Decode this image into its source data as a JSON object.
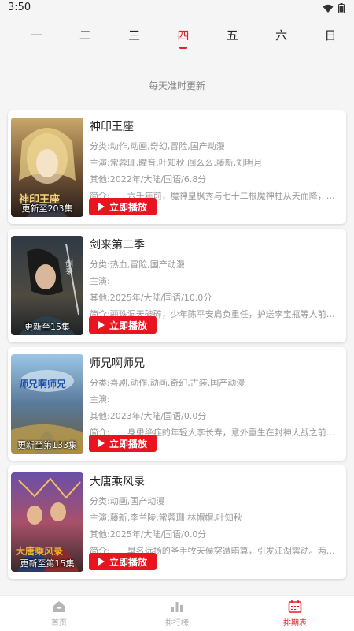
{
  "status": {
    "time": "3:50"
  },
  "days": [
    {
      "label": "一",
      "active": false
    },
    {
      "label": "二",
      "active": false
    },
    {
      "label": "三",
      "active": false
    },
    {
      "label": "四",
      "active": true
    },
    {
      "label": "五",
      "active": false
    },
    {
      "label": "六",
      "active": false
    },
    {
      "label": "日",
      "active": false
    }
  ],
  "subtitle": "每天准时更新",
  "play_label": "立即播放",
  "shows": [
    {
      "title": "神印王座",
      "genre": "分类:动作,动画,奇幻,冒险,国产动漫",
      "cast": "主演:常蓉珊,瞳音,叶知秋,阎么么,藤新,刘明月",
      "other": "其他:2022年/大陆/国语/6.8分",
      "intro": "简介:　　六千年前，魔神皇枫秀与七十二根魔神柱从天而降，所有…",
      "episode_badge": "更新至203集",
      "poster_art_text": "神印王座"
    },
    {
      "title": "剑来第二季",
      "genre": "分类:热血,冒险,国产动漫",
      "cast": "主演:",
      "other": "其他:2025年/大陆/国语/10.0分",
      "intro": "简介:骊珠洞天破碎，少年陈平安肩负重任，护送李宝瓶等人前往大…",
      "episode_badge": "更新至15集",
      "poster_art_text": "剑来"
    },
    {
      "title": "师兄啊师兄",
      "genre": "分类:喜剧,动作,动画,奇幻,古装,国产动漫",
      "cast": "主演:",
      "other": "其他:2023年/大陆/国语/0.0分",
      "intro": "简介:　　身患绝症的年轻人李长寿，意外重生在封神大战之前的上…",
      "episode_badge": "更新至第133集",
      "poster_art_text": "师兄啊师兄"
    },
    {
      "title": "大唐乘风录",
      "genre": "分类:动画,国产动漫",
      "cast": "主演:藤新,李兰陵,常蓉珊,林帽帽,叶知秋",
      "other": "其他:2025年/大陆/国语/0.0分",
      "intro": "简介:　　臭名远扬的圣手牧天侯突遭暗算，引发江湖震动。两位正…",
      "episode_badge": "更新至第15集",
      "poster_art_text": "大唐乘风录"
    }
  ],
  "nav": [
    {
      "label": "首页",
      "icon": "home-icon",
      "active": false
    },
    {
      "label": "排行榜",
      "icon": "chart-icon",
      "active": false
    },
    {
      "label": "排期表",
      "icon": "calendar-icon",
      "active": true
    }
  ],
  "colors": {
    "accent": "#e0202a",
    "play_button": "#e8141f"
  }
}
